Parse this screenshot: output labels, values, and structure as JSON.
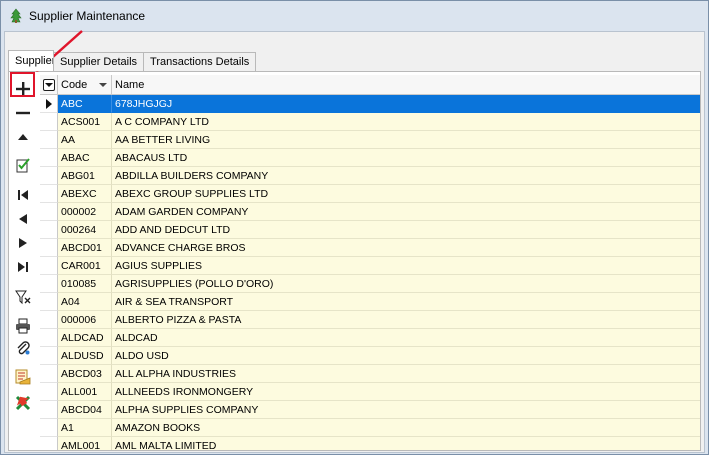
{
  "window": {
    "title": "Supplier Maintenance"
  },
  "tabs": [
    {
      "label": "Supplier"
    },
    {
      "label": "Supplier Details"
    },
    {
      "label": "Transactions Details"
    }
  ],
  "toolbar": {
    "buttons": [
      {
        "icon": "plus-icon"
      },
      {
        "icon": "minus-icon"
      },
      {
        "icon": "up-triangle-icon"
      },
      {
        "icon": "edit-check-icon"
      },
      {
        "icon": "first-record-icon"
      },
      {
        "icon": "previous-record-icon"
      },
      {
        "icon": "next-record-icon"
      },
      {
        "icon": "last-record-icon"
      },
      {
        "icon": "filter-icon"
      },
      {
        "icon": "print-icon"
      },
      {
        "icon": "attach-icon"
      },
      {
        "icon": "report-icon"
      },
      {
        "icon": "excel-export-icon"
      }
    ]
  },
  "grid": {
    "columns": [
      {
        "label": "Code"
      },
      {
        "label": "Name"
      }
    ],
    "selected_row": 0,
    "rows": [
      {
        "code": "ABC",
        "name": "678JHGJGJ"
      },
      {
        "code": "ACS001",
        "name": "A C COMPANY LTD"
      },
      {
        "code": "AA",
        "name": "AA BETTER LIVING"
      },
      {
        "code": "ABAC",
        "name": "ABACAUS LTD"
      },
      {
        "code": "ABG01",
        "name": "ABDILLA BUILDERS COMPANY"
      },
      {
        "code": "ABEXC",
        "name": "ABEXC GROUP SUPPLIES LTD"
      },
      {
        "code": "000002",
        "name": "ADAM GARDEN COMPANY"
      },
      {
        "code": "000264",
        "name": "ADD AND DEDCUT LTD"
      },
      {
        "code": "ABCD01",
        "name": "ADVANCE CHARGE BROS"
      },
      {
        "code": "CAR001",
        "name": "AGIUS SUPPLIES"
      },
      {
        "code": "010085",
        "name": "AGRISUPPLIES (POLLO D'ORO)"
      },
      {
        "code": "A04",
        "name": "AIR & SEA TRANSPORT"
      },
      {
        "code": "000006",
        "name": "ALBERTO PIZZA & PASTA"
      },
      {
        "code": "ALDCAD",
        "name": "ALDCAD"
      },
      {
        "code": "ALDUSD",
        "name": "ALDO USD"
      },
      {
        "code": "ABCD03",
        "name": "ALL ALPHA INDUSTRIES"
      },
      {
        "code": "ALL001",
        "name": "ALLNEEDS IRONMONGERY"
      },
      {
        "code": "ABCD04",
        "name": "ALPHA SUPPLIES COMPANY"
      },
      {
        "code": "A1",
        "name": "AMAZON BOOKS"
      },
      {
        "code": "AML001",
        "name": "AML MALTA LIMITED"
      }
    ]
  },
  "colors": {
    "selection": "#0a74da",
    "grid_background": "#fdfbdf",
    "annotation": "#e0152b"
  }
}
